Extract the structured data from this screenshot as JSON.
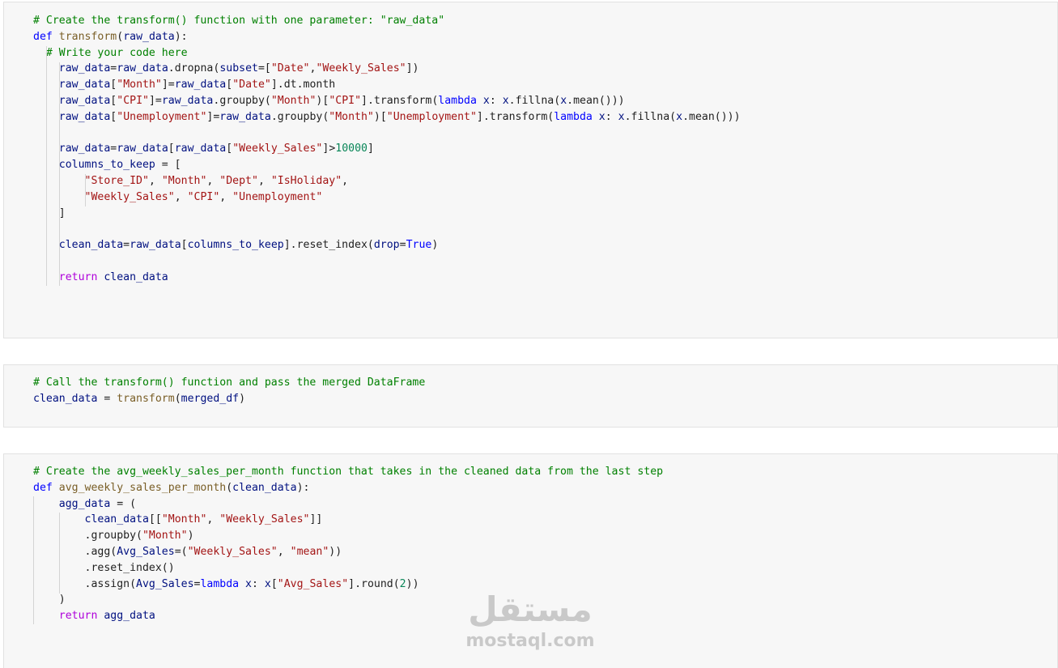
{
  "cells": [
    {
      "lines": [
        [
          [
            "cm",
            "# Create the transform() function with one parameter: \"raw_data\""
          ]
        ],
        [
          [
            "kw",
            "def "
          ],
          [
            "fn",
            "transform"
          ],
          [
            "pn",
            "("
          ],
          [
            "vr",
            "raw_data"
          ],
          [
            "pn",
            "):"
          ]
        ],
        [
          [
            "pn",
            "  "
          ],
          [
            "cm",
            "# Write your code here"
          ]
        ],
        [
          [
            "pn",
            "    "
          ],
          [
            "vr",
            "raw_data"
          ],
          [
            "pn",
            "="
          ],
          [
            "vr",
            "raw_data"
          ],
          [
            "pn",
            ".dropna("
          ],
          [
            "vr",
            "subset"
          ],
          [
            "pn",
            "=["
          ],
          [
            "st",
            "\"Date\""
          ],
          [
            "pn",
            ","
          ],
          [
            "st",
            "\"Weekly_Sales\""
          ],
          [
            "pn",
            "])"
          ]
        ],
        [
          [
            "pn",
            "    "
          ],
          [
            "vr",
            "raw_data"
          ],
          [
            "pn",
            "["
          ],
          [
            "st",
            "\"Month\""
          ],
          [
            "pn",
            "]="
          ],
          [
            "vr",
            "raw_data"
          ],
          [
            "pn",
            "["
          ],
          [
            "st",
            "\"Date\""
          ],
          [
            "pn",
            "].dt.month"
          ]
        ],
        [
          [
            "pn",
            "    "
          ],
          [
            "vr",
            "raw_data"
          ],
          [
            "pn",
            "["
          ],
          [
            "st",
            "\"CPI\""
          ],
          [
            "pn",
            "]="
          ],
          [
            "vr",
            "raw_data"
          ],
          [
            "pn",
            ".groupby("
          ],
          [
            "st",
            "\"Month\""
          ],
          [
            "pn",
            ")["
          ],
          [
            "st",
            "\"CPI\""
          ],
          [
            "pn",
            "].transform("
          ],
          [
            "kw",
            "lambda "
          ],
          [
            "vr",
            "x"
          ],
          [
            "pn",
            ": "
          ],
          [
            "vr",
            "x"
          ],
          [
            "pn",
            ".fillna("
          ],
          [
            "vr",
            "x"
          ],
          [
            "pn",
            ".mean()))"
          ]
        ],
        [
          [
            "pn",
            "    "
          ],
          [
            "vr",
            "raw_data"
          ],
          [
            "pn",
            "["
          ],
          [
            "st",
            "\"Unemployment\""
          ],
          [
            "pn",
            "]="
          ],
          [
            "vr",
            "raw_data"
          ],
          [
            "pn",
            ".groupby("
          ],
          [
            "st",
            "\"Month\""
          ],
          [
            "pn",
            ")["
          ],
          [
            "st",
            "\"Unemployment\""
          ],
          [
            "pn",
            "].transform("
          ],
          [
            "kw",
            "lambda "
          ],
          [
            "vr",
            "x"
          ],
          [
            "pn",
            ": "
          ],
          [
            "vr",
            "x"
          ],
          [
            "pn",
            ".fillna("
          ],
          [
            "vr",
            "x"
          ],
          [
            "pn",
            ".mean()))"
          ]
        ],
        [],
        [
          [
            "pn",
            "    "
          ],
          [
            "vr",
            "raw_data"
          ],
          [
            "pn",
            "="
          ],
          [
            "vr",
            "raw_data"
          ],
          [
            "pn",
            "["
          ],
          [
            "vr",
            "raw_data"
          ],
          [
            "pn",
            "["
          ],
          [
            "st",
            "\"Weekly_Sales\""
          ],
          [
            "pn",
            "]>"
          ],
          [
            "nm",
            "10000"
          ],
          [
            "pn",
            "]"
          ]
        ],
        [
          [
            "pn",
            "    "
          ],
          [
            "vr",
            "columns_to_keep"
          ],
          [
            "pn",
            " = ["
          ]
        ],
        [
          [
            "pn",
            "        "
          ],
          [
            "st",
            "\"Store_ID\""
          ],
          [
            "pn",
            ", "
          ],
          [
            "st",
            "\"Month\""
          ],
          [
            "pn",
            ", "
          ],
          [
            "st",
            "\"Dept\""
          ],
          [
            "pn",
            ", "
          ],
          [
            "st",
            "\"IsHoliday\""
          ],
          [
            "pn",
            ","
          ]
        ],
        [
          [
            "pn",
            "        "
          ],
          [
            "st",
            "\"Weekly_Sales\""
          ],
          [
            "pn",
            ", "
          ],
          [
            "st",
            "\"CPI\""
          ],
          [
            "pn",
            ", "
          ],
          [
            "st",
            "\"Unemployment\""
          ]
        ],
        [
          [
            "pn",
            "    ]"
          ]
        ],
        [],
        [
          [
            "pn",
            "    "
          ],
          [
            "vr",
            "clean_data"
          ],
          [
            "pn",
            "="
          ],
          [
            "vr",
            "raw_data"
          ],
          [
            "pn",
            "["
          ],
          [
            "vr",
            "columns_to_keep"
          ],
          [
            "pn",
            "].reset_index("
          ],
          [
            "vr",
            "drop"
          ],
          [
            "pn",
            "="
          ],
          [
            "kw",
            "True"
          ],
          [
            "pn",
            ")"
          ]
        ],
        [],
        [
          [
            "pn",
            "    "
          ],
          [
            "ret",
            "return "
          ],
          [
            "vr",
            "clean_data"
          ]
        ]
      ]
    },
    {
      "lines": [
        [
          [
            "cm",
            "# Call the transform() function and pass the merged DataFrame"
          ]
        ],
        [
          [
            "vr",
            "clean_data"
          ],
          [
            "pn",
            " = "
          ],
          [
            "fn",
            "transform"
          ],
          [
            "pn",
            "("
          ],
          [
            "vr",
            "merged_df"
          ],
          [
            "pn",
            ")"
          ]
        ]
      ]
    },
    {
      "lines": [
        [
          [
            "cm",
            "# Create the avg_weekly_sales_per_month function that takes in the cleaned data from the last step"
          ]
        ],
        [
          [
            "kw",
            "def "
          ],
          [
            "fn",
            "avg_weekly_sales_per_month"
          ],
          [
            "pn",
            "("
          ],
          [
            "vr",
            "clean_data"
          ],
          [
            "pn",
            "):"
          ]
        ],
        [
          [
            "pn",
            "    "
          ],
          [
            "vr",
            "agg_data"
          ],
          [
            "pn",
            " = ("
          ]
        ],
        [
          [
            "pn",
            "        "
          ],
          [
            "vr",
            "clean_data"
          ],
          [
            "pn",
            "[["
          ],
          [
            "st",
            "\"Month\""
          ],
          [
            "pn",
            ", "
          ],
          [
            "st",
            "\"Weekly_Sales\""
          ],
          [
            "pn",
            "]]"
          ]
        ],
        [
          [
            "pn",
            "        .groupby("
          ],
          [
            "st",
            "\"Month\""
          ],
          [
            "pn",
            ")"
          ]
        ],
        [
          [
            "pn",
            "        .agg("
          ],
          [
            "vr",
            "Avg_Sales"
          ],
          [
            "pn",
            "=("
          ],
          [
            "st",
            "\"Weekly_Sales\""
          ],
          [
            "pn",
            ", "
          ],
          [
            "st",
            "\"mean\""
          ],
          [
            "pn",
            "))"
          ]
        ],
        [
          [
            "pn",
            "        .reset_index()"
          ]
        ],
        [
          [
            "pn",
            "        .assign("
          ],
          [
            "vr",
            "Avg_Sales"
          ],
          [
            "pn",
            "="
          ],
          [
            "kw",
            "lambda "
          ],
          [
            "vr",
            "x"
          ],
          [
            "pn",
            ": "
          ],
          [
            "vr",
            "x"
          ],
          [
            "pn",
            "["
          ],
          [
            "st",
            "\"Avg_Sales\""
          ],
          [
            "pn",
            "].round("
          ],
          [
            "nm",
            "2"
          ],
          [
            "pn",
            "))"
          ]
        ],
        [
          [
            "pn",
            "    )"
          ]
        ],
        [
          [
            "pn",
            "    "
          ],
          [
            "ret",
            "return "
          ],
          [
            "vr",
            "agg_data"
          ]
        ]
      ]
    }
  ],
  "watermark": {
    "arabic": "مستقل",
    "latin": "mostaql.com"
  }
}
